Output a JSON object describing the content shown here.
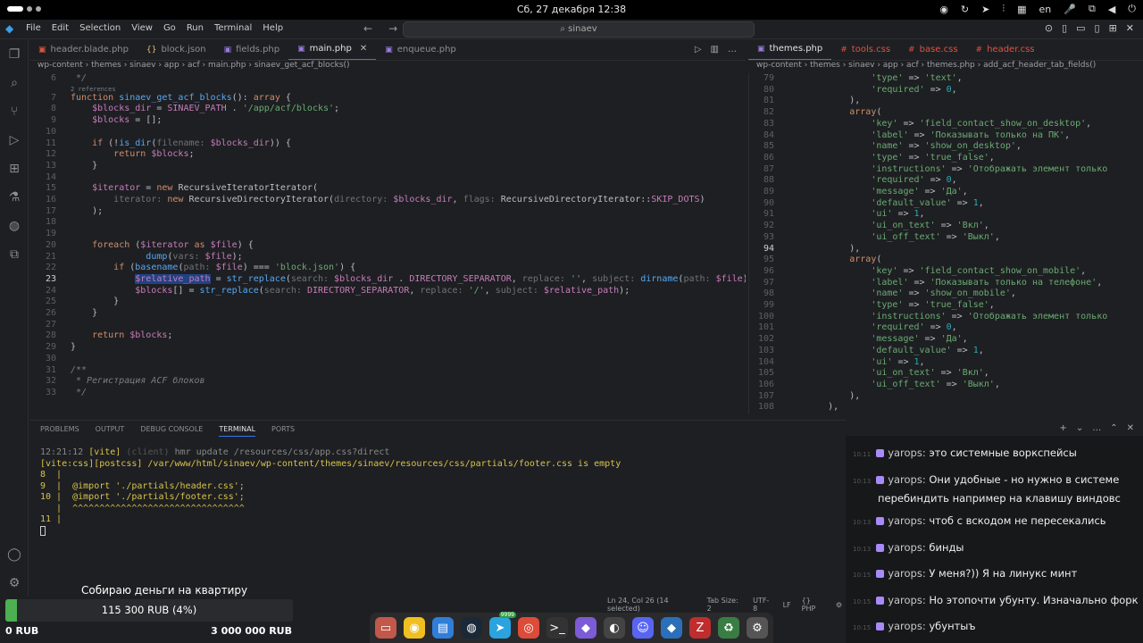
{
  "system_bar": {
    "clock": "Сб, 27 декабря  12:38",
    "language": "en"
  },
  "menubar": {
    "items": [
      "File",
      "Edit",
      "Selection",
      "View",
      "Go",
      "Run",
      "Terminal",
      "Help"
    ],
    "search_text": "sinaev"
  },
  "left_tabs": [
    {
      "label": "header.blade.php",
      "icon": "php-file-icon"
    },
    {
      "label": "block.json",
      "icon": "json-file-icon"
    },
    {
      "label": "fields.php",
      "icon": "php-file-icon"
    },
    {
      "label": "main.php",
      "icon": "php-file-icon",
      "active": true
    },
    {
      "label": "enqueue.php",
      "icon": "php-file-icon"
    }
  ],
  "right_tabs": [
    {
      "label": "themes.php",
      "icon": "php-file-icon",
      "active": true
    },
    {
      "label": "tools.css",
      "icon": "css-file-icon"
    },
    {
      "label": "base.css",
      "icon": "css-file-icon"
    },
    {
      "label": "header.css",
      "icon": "css-file-icon"
    }
  ],
  "left_breadcrumb": "wp-content  ›  themes  ›  sinaev  ›  app  ›  acf  ›  main.php  ›  sinaev_get_acf_blocks()",
  "right_breadcrumb": "wp-content  ›  themes  ›  sinaev  ›  app  ›  acf  ›  themes.php  ›  add_acf_header_tab_fields()",
  "left_code": {
    "references": "2 references",
    "lines": [
      {
        "n": "6",
        "html": "<span class='cmt'> */</span>"
      },
      {
        "n": "7",
        "html": "<span class='kw'>function</span> <span class='fn'>sinaev_get_acf_blocks</span>(): <span class='kw'>array</span> {"
      },
      {
        "n": "8",
        "html": "    <span class='var'>$blocks_dir</span> = <span class='const'>SINAEV_PATH</span> . <span class='str'>'/app/acf/blocks'</span>;"
      },
      {
        "n": "9",
        "html": "    <span class='var'>$blocks</span> = [];"
      },
      {
        "n": "10",
        "html": ""
      },
      {
        "n": "11",
        "html": "    <span class='kw'>if</span> (!<span class='fn'>is_dir</span>(<span class='hint'>filename: </span><span class='var'>$blocks_dir</span>)) {"
      },
      {
        "n": "12",
        "html": "        <span class='kw'>return</span> <span class='var'>$blocks</span>;"
      },
      {
        "n": "13",
        "html": "    }"
      },
      {
        "n": "14",
        "html": ""
      },
      {
        "n": "15",
        "html": "    <span class='var'>$iterator</span> = <span class='kw'>new</span> <span class='cls'>RecursiveIteratorIterator</span>("
      },
      {
        "n": "16",
        "html": "        <span class='hint'>iterator: </span><span class='kw'>new</span> <span class='cls'>RecursiveDirectoryIterator</span>(<span class='hint'>directory: </span><span class='var'>$blocks_dir</span>, <span class='hint'>flags: </span><span class='cls'>RecursiveDirectoryIterator</span>::<span class='const'>SKIP_DOTS</span>)"
      },
      {
        "n": "17",
        "html": "    );"
      },
      {
        "n": "18",
        "html": ""
      },
      {
        "n": "19",
        "html": ""
      },
      {
        "n": "20",
        "html": "    <span class='kw'>foreach</span> (<span class='var'>$iterator</span> <span class='kw'>as</span> <span class='var'>$file</span>) {"
      },
      {
        "n": "21",
        "html": "              <span class='fn'>dump</span>(<span class='hint'>vars: </span><span class='var'>$file</span>);"
      },
      {
        "n": "22",
        "html": "        <span class='kw'>if</span> (<span class='fn'>basename</span>(<span class='hint'>path: </span><span class='var'>$file</span>) === <span class='str'>'block.json'</span>) {"
      },
      {
        "n": "23",
        "html": "            <span class='sel'><span class='var'>$relative_path</span></span> = <span class='fn'>str_replace</span>(<span class='hint'>search: </span><span class='var'>$blocks_dir</span> . <span class='const'>DIRECTORY_SEPARATOR</span>, <span class='hint'>replace: </span><span class='str'>''</span>, <span class='hint'>subject: </span><span class='fn'>dirname</span>(<span class='hint'>path: </span><span class='var'>$file</span>));",
        "current": true
      },
      {
        "n": "24",
        "html": "            <span class='var'>$blocks</span>[] = <span class='fn'>str_replace</span>(<span class='hint'>search: </span><span class='const'>DIRECTORY_SEPARATOR</span>, <span class='hint'>replace: </span><span class='str'>'/'</span>, <span class='hint'>subject: </span><span class='var'>$relative_path</span>);"
      },
      {
        "n": "25",
        "html": "        }"
      },
      {
        "n": "26",
        "html": "    }"
      },
      {
        "n": "27",
        "html": ""
      },
      {
        "n": "28",
        "html": "    <span class='kw'>return</span> <span class='var'>$blocks</span>;"
      },
      {
        "n": "29",
        "html": "}"
      },
      {
        "n": "30",
        "html": ""
      },
      {
        "n": "31",
        "html": "<span class='cmt'>/**</span>"
      },
      {
        "n": "32",
        "html": "<span class='cmt'> * Регистрация ACF блоков</span>"
      },
      {
        "n": "33",
        "html": "<span class='cmt'> */</span>"
      }
    ]
  },
  "right_code": {
    "lines": [
      {
        "n": "79",
        "html": "                <span class='str'>'type'</span> => <span class='str'>'text'</span>,"
      },
      {
        "n": "80",
        "html": "                <span class='str'>'required'</span> => <span class='num'>0</span>,"
      },
      {
        "n": "81",
        "html": "            ),"
      },
      {
        "n": "82",
        "html": "            <span class='kw'>array</span>("
      },
      {
        "n": "83",
        "html": "                <span class='str'>'key'</span> => <span class='str'>'field_contact_show_on_desktop'</span>,"
      },
      {
        "n": "84",
        "html": "                <span class='str'>'label'</span> => <span class='str'>'Показывать только на ПК'</span>,"
      },
      {
        "n": "85",
        "html": "                <span class='str'>'name'</span> => <span class='str'>'show_on_desktop'</span>,"
      },
      {
        "n": "86",
        "html": "                <span class='str'>'type'</span> => <span class='str'>'true_false'</span>,"
      },
      {
        "n": "87",
        "html": "                <span class='str'>'instructions'</span> => <span class='str'>'Отображать элемент только</span>"
      },
      {
        "n": "88",
        "html": "                <span class='str'>'required'</span> => <span class='num'>0</span>,"
      },
      {
        "n": "89",
        "html": "                <span class='str'>'message'</span> => <span class='str'>'Да'</span>,"
      },
      {
        "n": "90",
        "html": "                <span class='str'>'default_value'</span> => <span class='num'>1</span>,"
      },
      {
        "n": "91",
        "html": "                <span class='str'>'ui'</span> => <span class='num'>1</span>,"
      },
      {
        "n": "92",
        "html": "                <span class='str'>'ui_on_text'</span> => <span class='str'>'Вкл'</span>,"
      },
      {
        "n": "93",
        "html": "                <span class='str'>'ui_off_text'</span> => <span class='str'>'Выкл'</span>,"
      },
      {
        "n": "94",
        "html": "            ),",
        "current": true
      },
      {
        "n": "95",
        "html": "            <span class='kw'>array</span>("
      },
      {
        "n": "96",
        "html": "                <span class='str'>'key'</span> => <span class='str'>'field_contact_show_on_mobile'</span>,"
      },
      {
        "n": "97",
        "html": "                <span class='str'>'label'</span> => <span class='str'>'Показывать только на телефоне'</span>,"
      },
      {
        "n": "98",
        "html": "                <span class='str'>'name'</span> => <span class='str'>'show_on_mobile'</span>,"
      },
      {
        "n": "99",
        "html": "                <span class='str'>'type'</span> => <span class='str'>'true_false'</span>,"
      },
      {
        "n": "100",
        "html": "                <span class='str'>'instructions'</span> => <span class='str'>'Отображать элемент только</span>"
      },
      {
        "n": "101",
        "html": "                <span class='str'>'required'</span> => <span class='num'>0</span>,"
      },
      {
        "n": "102",
        "html": "                <span class='str'>'message'</span> => <span class='str'>'Да'</span>,"
      },
      {
        "n": "103",
        "html": "                <span class='str'>'default_value'</span> => <span class='num'>1</span>,"
      },
      {
        "n": "104",
        "html": "                <span class='str'>'ui'</span> => <span class='num'>1</span>,"
      },
      {
        "n": "105",
        "html": "                <span class='str'>'ui_on_text'</span> => <span class='str'>'Вкл'</span>,"
      },
      {
        "n": "106",
        "html": "                <span class='str'>'ui_off_text'</span> => <span class='str'>'Выкл'</span>,"
      },
      {
        "n": "107",
        "html": "            ),"
      },
      {
        "n": "108",
        "html": "        ),"
      }
    ]
  },
  "panel": {
    "tabs": [
      "PROBLEMS",
      "OUTPUT",
      "DEBUG CONSOLE",
      "TERMINAL",
      "PORTS"
    ],
    "active_tab": "TERMINAL",
    "terminal_lines": [
      "<span class='t-gray'>12:21:12</span> <span class='t-yellow'>[vite]</span> <span class='t-dim'>(client)</span> <span class='t-gray'>hmr update /resources/css/app.css?direct</span>",
      "<span class='t-yellow'>[vite:css][postcss] /var/www/html/sinaev/wp-content/themes/sinaev/resources/css/partials/footer.css is empty</span>",
      "<span class='t-yellow'>8  |</span>",
      "<span class='t-yellow'>9  |  @import './partials/header.css';</span>",
      "<span class='t-yellow'>10 |  @import './partials/footer.css';</span>",
      "<span class='t-yellow'>   |  ^^^^^^^^^^^^^^^^^^^^^^^^^^^^^^^^</span>",
      "<span class='t-yellow'>11 |</span>"
    ]
  },
  "statusbar": {
    "position": "Ln 24, Col 26 (14 selected)",
    "tab_size": "Tab Size: 2",
    "encoding": "UTF-8",
    "eol": "LF",
    "language": "PHP"
  },
  "chat": {
    "messages": [
      {
        "time": "10:11",
        "user": "yarops",
        "text": "это системные воркспейсы"
      },
      {
        "time": "10:13",
        "user": "yarops",
        "text": "Они удобные - но нужно в системе",
        "cont": "перебиндить например на клавишу виндовс"
      },
      {
        "time": "10:13",
        "user": "yarops",
        "text": "чтоб с вскодом не пересекались"
      },
      {
        "time": "10:13",
        "user": "yarops",
        "text": "бинды"
      },
      {
        "time": "10:15",
        "user": "yarops",
        "text": "У меня?)) Я на линукс минт"
      },
      {
        "time": "10:15",
        "user": "yarops",
        "text": "Но этопочти убунту. Изначально форк"
      },
      {
        "time": "10:15",
        "user": "yarops",
        "text": "убунтыъ"
      }
    ]
  },
  "donation": {
    "title": "Собираю деньги на квартиру",
    "progress_text": "115 300 RUB (4%)",
    "progress_fraction": 0.04,
    "min_label": "0 RUB",
    "max_label": "3 000 000 RUB",
    "color": "#4caf50"
  },
  "dock": {
    "apps": [
      "files-icon",
      "rhythmbox-icon",
      "text-editor-icon",
      "steam-icon",
      "telegram-icon",
      "chrome-icon",
      "terminal-icon",
      "obsidian-icon",
      "obs-icon",
      "discord-icon",
      "vscode-icon",
      "filezilla-icon",
      "trash-icon",
      "settings-icon"
    ],
    "telegram_badge": "9999"
  }
}
